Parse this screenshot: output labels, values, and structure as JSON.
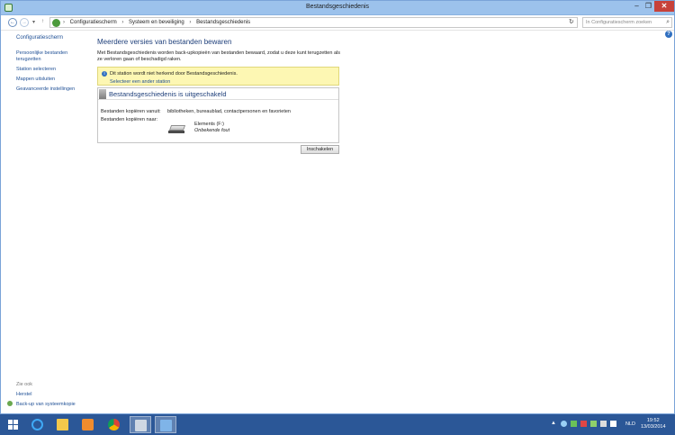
{
  "window": {
    "title": "Bestandsgeschiedenis"
  },
  "nav": {
    "back": "←",
    "forward": "→",
    "recent": "▾",
    "up": "↑",
    "breadcrumbs": [
      "Configuratiescherm",
      "Systeem en beveiliging",
      "Bestandsgeschiedenis"
    ],
    "separator": "›",
    "search_placeholder": "In Configuratiescherm zoeken"
  },
  "sidebar": {
    "home": "Configuratiescherm",
    "links": [
      "Persoonlijke bestanden terugzetten",
      "Station selecteren",
      "Mappen uitsluiten",
      "Geavanceerde instellingen"
    ],
    "see_also_header": "Zie ook",
    "see_also": [
      "Herstel",
      "Back-up van systeemkopie"
    ]
  },
  "main": {
    "heading": "Meerdere versies van bestanden bewaren",
    "description": "Met Bestandsgeschiedenis worden back-upkopieën van bestanden bewaard, zodat u deze kunt terugzetten als ze verloren gaan of beschadigd raken.",
    "notice": {
      "message": "Dit station wordt niet herkend door Bestandsgeschiedenis.",
      "action": "Selecteer een ander station"
    },
    "panel": {
      "title": "Bestandsgeschiedenis is uitgeschakeld",
      "copy_from_label": "Bestanden kopiëren vanuit:",
      "copy_from_value": "bibliotheken, bureaublad, contactpersonen en favorieten",
      "copy_to_label": "Bestanden kopiëren naar:",
      "drive_name": "Elements (F:)",
      "drive_status": "Onbekende fout"
    },
    "enable_button": "Inschakelen"
  },
  "taskbar": {
    "language": "NLD",
    "time": "19:52",
    "date": "13/03/2014"
  },
  "colors": {
    "accent": "#2b5797",
    "link": "#1e4f95",
    "notice_bg": "#fdf7b3",
    "close_button": "#c7413a"
  }
}
